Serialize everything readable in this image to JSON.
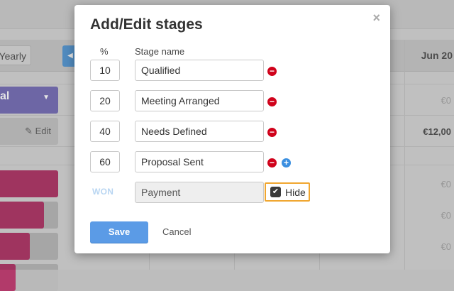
{
  "background": {
    "yearly_label": "Yearly",
    "arrow_glyph": "◀",
    "jun_label": "Jun 20",
    "group_label": "al",
    "group_caret": "▼",
    "edit_label": "Edit",
    "euro_values": [
      "€0",
      "€12,00",
      "€0",
      "€0",
      "€0"
    ],
    "colors": {
      "purple": "#7a72b8",
      "pink": "#b23a6a",
      "blue": "#5b9bd5"
    }
  },
  "modal": {
    "title": "Add/Edit stages",
    "close_glyph": "×",
    "pct_header": "%",
    "name_header": "Stage name",
    "stages": [
      {
        "percent": "10",
        "name": "Qualified"
      },
      {
        "percent": "20",
        "name": "Meeting Arranged"
      },
      {
        "percent": "40",
        "name": "Needs Defined"
      },
      {
        "percent": "60",
        "name": "Proposal Sent"
      }
    ],
    "won": {
      "label": "WON",
      "name": "Payment",
      "hide_label": "Hide",
      "hide_checked": true
    },
    "remove_icon": "minus-circle-icon",
    "add_icon": "plus-circle-icon",
    "save_label": "Save",
    "cancel_label": "Cancel",
    "colors": {
      "remove": "#d0021b",
      "add": "#3b8fe0",
      "save": "#5b9be6",
      "hide_outline": "#f0a630"
    }
  }
}
